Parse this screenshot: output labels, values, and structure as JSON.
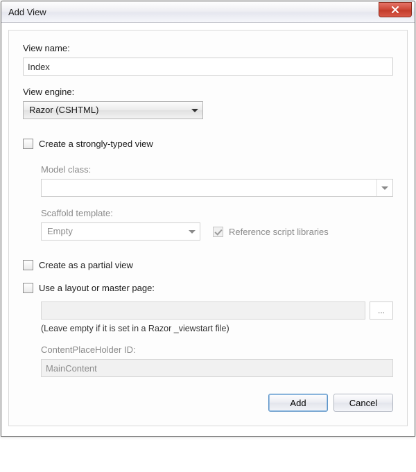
{
  "window": {
    "title": "Add View"
  },
  "labels": {
    "viewName": "View name:",
    "viewEngine": "View engine:",
    "stronglyTyped": "Create a strongly-typed view",
    "modelClass": "Model class:",
    "scaffoldTemplate": "Scaffold template:",
    "referenceScript": "Reference script libraries",
    "partialView": "Create as a partial view",
    "useLayout": "Use a layout or master page:",
    "leaveEmptyNote": "(Leave empty if it is set in a Razor _viewstart file)",
    "contentPlaceholder": "ContentPlaceHolder ID:"
  },
  "values": {
    "viewName": "Index",
    "viewEngine": "Razor (CSHTML)",
    "modelClass": "",
    "scaffoldTemplate": "Empty",
    "layoutPath": "",
    "contentPlaceholder": "MainContent",
    "browse": "..."
  },
  "checks": {
    "stronglyTyped": false,
    "referenceScript": true,
    "partialView": false,
    "useLayout": false
  },
  "buttons": {
    "add": "Add",
    "cancel": "Cancel"
  }
}
